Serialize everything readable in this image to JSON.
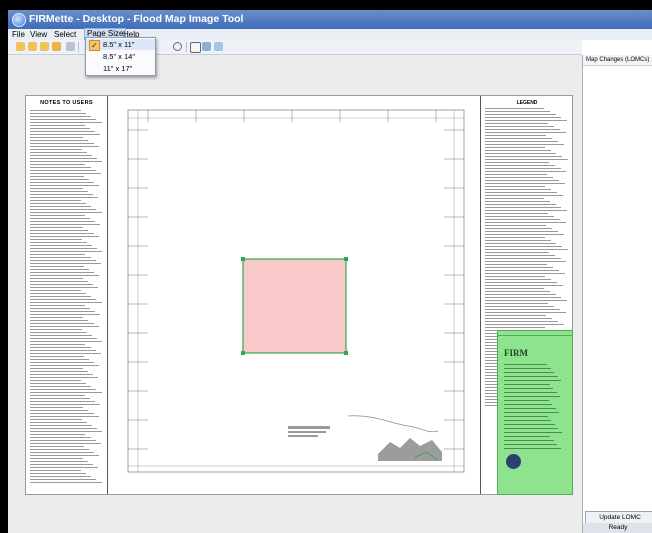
{
  "window": {
    "title": "FIRMette - Desktop - Flood Map Image Tool"
  },
  "menu": {
    "items": [
      "File",
      "View",
      "Select",
      "Page Size",
      "Help"
    ],
    "active": "Page Size"
  },
  "page_size_menu": {
    "options": [
      {
        "label": "8.5\" x 11\"",
        "checked": true
      },
      {
        "label": "8.5\" x 14\"",
        "checked": false
      },
      {
        "label": "11\" x 17\"",
        "checked": false
      }
    ]
  },
  "toolbar": {
    "icons": [
      "open-icon",
      "open-icon",
      "open-icon",
      "save-icon",
      "print-icon",
      "zoom-icon",
      "zoom-icon",
      "select-icon",
      "pan-icon",
      "refresh-icon"
    ]
  },
  "map": {
    "notes_title": "NOTES TO USERS",
    "legend_title": "LEGEND",
    "title_block": {
      "heading": "FIRM"
    }
  },
  "right_panel": {
    "header": "Map Changes (LOMCs)",
    "update_button": "Update LOMC",
    "status": "Ready"
  },
  "colors": {
    "selection_fill": "#f9c9c9",
    "selection_border": "#2faa4a",
    "title_block": "#8ee38e",
    "titlebar": "#3f6cb8"
  }
}
